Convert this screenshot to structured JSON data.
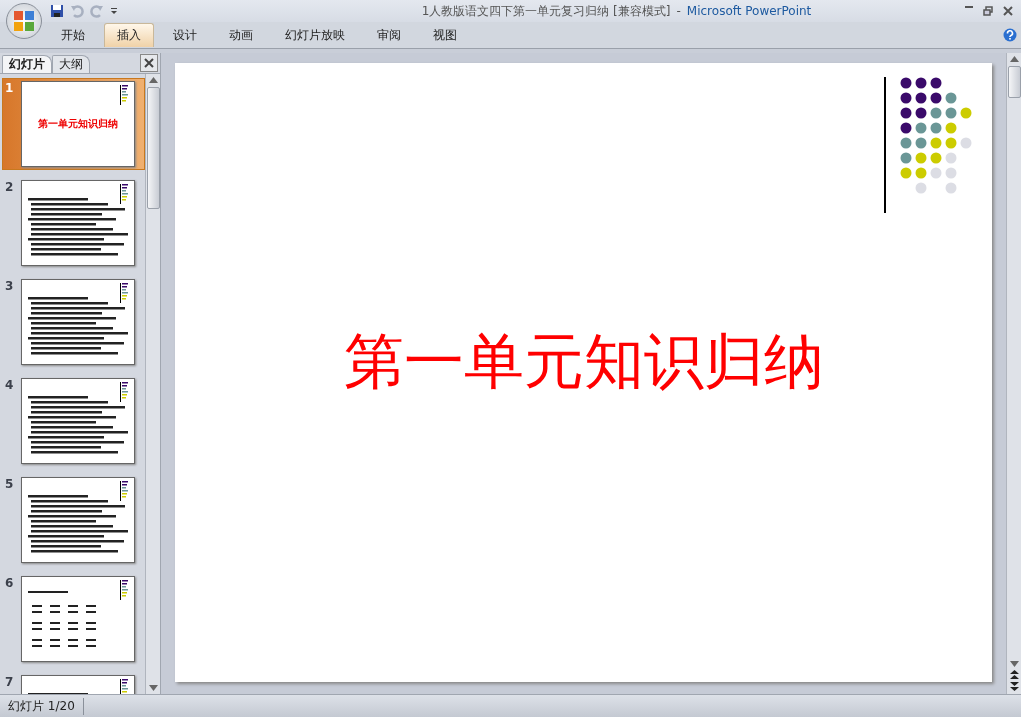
{
  "window": {
    "title": "1人教版语文四下第一单元复习归纳 [兼容模式]",
    "separator": "-",
    "app_name": "Microsoft PowerPoint"
  },
  "quick_access": {
    "redo_disabled": true,
    "undo_disabled": true
  },
  "ribbon_tabs": [
    {
      "label": "开始",
      "selected": false
    },
    {
      "label": "插入",
      "selected": true
    },
    {
      "label": "设计",
      "selected": false
    },
    {
      "label": "动画",
      "selected": false
    },
    {
      "label": "幻灯片放映",
      "selected": false
    },
    {
      "label": "审阅",
      "selected": false
    },
    {
      "label": "视图",
      "selected": false
    }
  ],
  "pane_tabs": [
    {
      "label": "幻灯片",
      "selected": true
    },
    {
      "label": "大纲",
      "selected": false
    }
  ],
  "slides": [
    {
      "number": "1",
      "selected": true,
      "kind": "title",
      "title": "第一单元知识归纳"
    },
    {
      "number": "2",
      "selected": false,
      "kind": "text"
    },
    {
      "number": "3",
      "selected": false,
      "kind": "text"
    },
    {
      "number": "4",
      "selected": false,
      "kind": "text"
    },
    {
      "number": "5",
      "selected": false,
      "kind": "text"
    },
    {
      "number": "6",
      "selected": false,
      "kind": "grid"
    },
    {
      "number": "7",
      "selected": false,
      "kind": "text"
    }
  ],
  "current_slide": {
    "title": "第一单元知识归纳"
  },
  "status_bar": {
    "slide_position": "幻灯片 1/20"
  }
}
